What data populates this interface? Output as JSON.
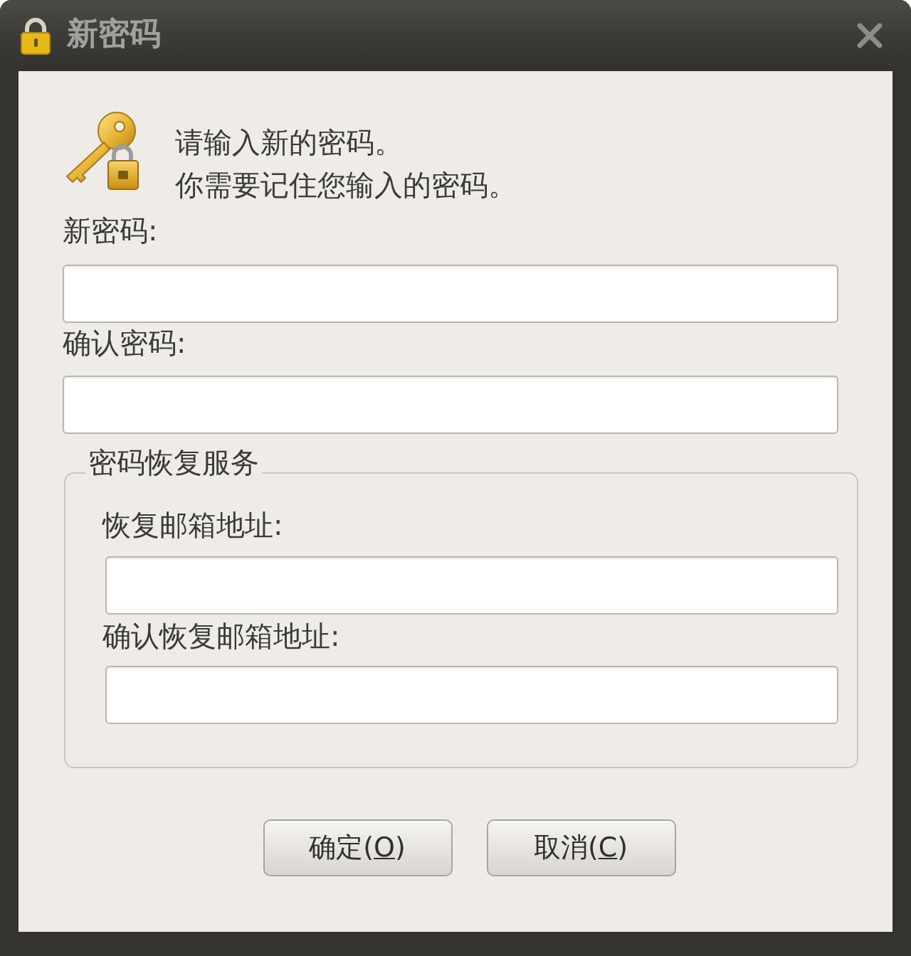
{
  "window": {
    "title": "新密码"
  },
  "message": {
    "lines": [
      "请输入新的密码。",
      "你需要记住您输入的密码。"
    ]
  },
  "fields": [
    {
      "label": "新密码:"
    },
    {
      "label": "确认密码:"
    }
  ],
  "recovery_group": {
    "legend": "密码恢复服务",
    "fields": [
      {
        "label": "恢复邮箱地址:"
      },
      {
        "label": "确认恢复邮箱地址:"
      }
    ]
  },
  "buttons": [
    {
      "text": "确定(",
      "access_key": "O",
      "text_after": ")"
    },
    {
      "text": "取消(",
      "access_key": "C",
      "text_after": ")"
    }
  ]
}
